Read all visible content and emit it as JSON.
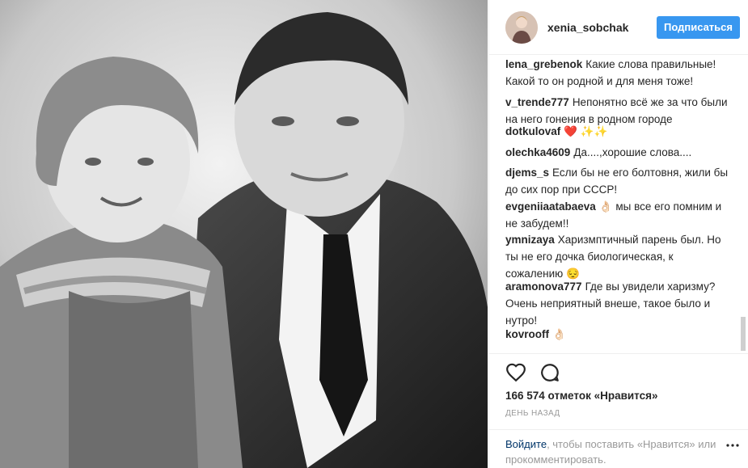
{
  "post": {
    "username": "xenia_sobchak",
    "follow_label": "Подписаться"
  },
  "comments": [
    {
      "user": "lena_grebenok",
      "text": "Какие слова правильные! Какой то он родной и для меня тоже!"
    },
    {
      "user": "v_trende777",
      "text": "Непонятно всё же за что были на него гонения в родном городе"
    },
    {
      "user": "dotkulovaf",
      "text": "❤️ ✨✨"
    },
    {
      "user": "olechka4609",
      "text": "Да....,хорошие слова...."
    },
    {
      "user": "djems_s",
      "text": "Если бы не его болтовня, жили бы до сих пор при СССР!"
    },
    {
      "user": "evgeniiaatabaeva",
      "text": "👌🏻 мы все его помним и не забудем!!"
    },
    {
      "user": "ymnizaya",
      "text": "Харизмптичный парень был. Но ты не его дочка биологическая, к сожалению 😔"
    },
    {
      "user": "aramonova777",
      "text": "Где вы увидели харизму? Очень неприятный внеше, такое было и нутро!"
    },
    {
      "user": "kovrooff",
      "text": "👌🏻"
    }
  ],
  "stats": {
    "likes_text": "166 574 отметок «Нравится»",
    "time_text": "День назад"
  },
  "login": {
    "link": "Войдите",
    "rest": ", чтобы поставить «Нравится» или прокомментировать."
  },
  "icons": [
    "heart-icon",
    "comment-icon",
    "more-dots-icon"
  ]
}
